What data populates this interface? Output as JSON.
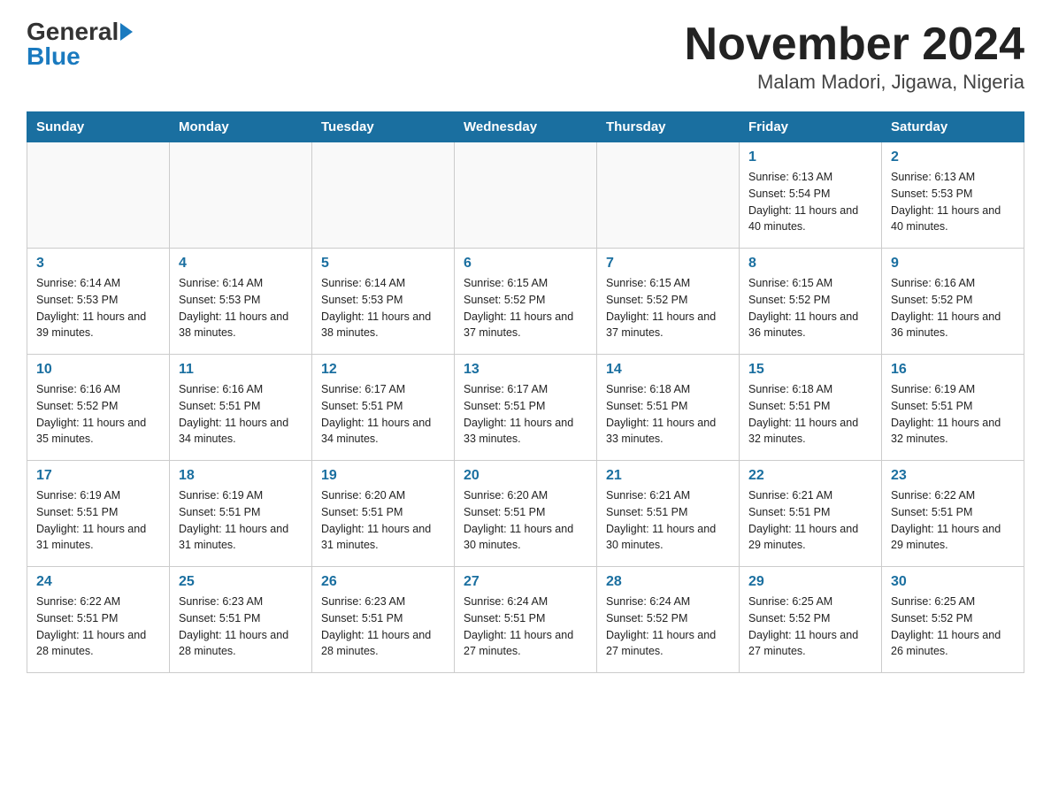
{
  "logo": {
    "general": "General",
    "blue": "Blue"
  },
  "header": {
    "month_year": "November 2024",
    "location": "Malam Madori, Jigawa, Nigeria"
  },
  "weekdays": [
    "Sunday",
    "Monday",
    "Tuesday",
    "Wednesday",
    "Thursday",
    "Friday",
    "Saturday"
  ],
  "weeks": [
    [
      {
        "day": "",
        "sunrise": "",
        "sunset": "",
        "daylight": ""
      },
      {
        "day": "",
        "sunrise": "",
        "sunset": "",
        "daylight": ""
      },
      {
        "day": "",
        "sunrise": "",
        "sunset": "",
        "daylight": ""
      },
      {
        "day": "",
        "sunrise": "",
        "sunset": "",
        "daylight": ""
      },
      {
        "day": "",
        "sunrise": "",
        "sunset": "",
        "daylight": ""
      },
      {
        "day": "1",
        "sunrise": "Sunrise: 6:13 AM",
        "sunset": "Sunset: 5:54 PM",
        "daylight": "Daylight: 11 hours and 40 minutes."
      },
      {
        "day": "2",
        "sunrise": "Sunrise: 6:13 AM",
        "sunset": "Sunset: 5:53 PM",
        "daylight": "Daylight: 11 hours and 40 minutes."
      }
    ],
    [
      {
        "day": "3",
        "sunrise": "Sunrise: 6:14 AM",
        "sunset": "Sunset: 5:53 PM",
        "daylight": "Daylight: 11 hours and 39 minutes."
      },
      {
        "day": "4",
        "sunrise": "Sunrise: 6:14 AM",
        "sunset": "Sunset: 5:53 PM",
        "daylight": "Daylight: 11 hours and 38 minutes."
      },
      {
        "day": "5",
        "sunrise": "Sunrise: 6:14 AM",
        "sunset": "Sunset: 5:53 PM",
        "daylight": "Daylight: 11 hours and 38 minutes."
      },
      {
        "day": "6",
        "sunrise": "Sunrise: 6:15 AM",
        "sunset": "Sunset: 5:52 PM",
        "daylight": "Daylight: 11 hours and 37 minutes."
      },
      {
        "day": "7",
        "sunrise": "Sunrise: 6:15 AM",
        "sunset": "Sunset: 5:52 PM",
        "daylight": "Daylight: 11 hours and 37 minutes."
      },
      {
        "day": "8",
        "sunrise": "Sunrise: 6:15 AM",
        "sunset": "Sunset: 5:52 PM",
        "daylight": "Daylight: 11 hours and 36 minutes."
      },
      {
        "day": "9",
        "sunrise": "Sunrise: 6:16 AM",
        "sunset": "Sunset: 5:52 PM",
        "daylight": "Daylight: 11 hours and 36 minutes."
      }
    ],
    [
      {
        "day": "10",
        "sunrise": "Sunrise: 6:16 AM",
        "sunset": "Sunset: 5:52 PM",
        "daylight": "Daylight: 11 hours and 35 minutes."
      },
      {
        "day": "11",
        "sunrise": "Sunrise: 6:16 AM",
        "sunset": "Sunset: 5:51 PM",
        "daylight": "Daylight: 11 hours and 34 minutes."
      },
      {
        "day": "12",
        "sunrise": "Sunrise: 6:17 AM",
        "sunset": "Sunset: 5:51 PM",
        "daylight": "Daylight: 11 hours and 34 minutes."
      },
      {
        "day": "13",
        "sunrise": "Sunrise: 6:17 AM",
        "sunset": "Sunset: 5:51 PM",
        "daylight": "Daylight: 11 hours and 33 minutes."
      },
      {
        "day": "14",
        "sunrise": "Sunrise: 6:18 AM",
        "sunset": "Sunset: 5:51 PM",
        "daylight": "Daylight: 11 hours and 33 minutes."
      },
      {
        "day": "15",
        "sunrise": "Sunrise: 6:18 AM",
        "sunset": "Sunset: 5:51 PM",
        "daylight": "Daylight: 11 hours and 32 minutes."
      },
      {
        "day": "16",
        "sunrise": "Sunrise: 6:19 AM",
        "sunset": "Sunset: 5:51 PM",
        "daylight": "Daylight: 11 hours and 32 minutes."
      }
    ],
    [
      {
        "day": "17",
        "sunrise": "Sunrise: 6:19 AM",
        "sunset": "Sunset: 5:51 PM",
        "daylight": "Daylight: 11 hours and 31 minutes."
      },
      {
        "day": "18",
        "sunrise": "Sunrise: 6:19 AM",
        "sunset": "Sunset: 5:51 PM",
        "daylight": "Daylight: 11 hours and 31 minutes."
      },
      {
        "day": "19",
        "sunrise": "Sunrise: 6:20 AM",
        "sunset": "Sunset: 5:51 PM",
        "daylight": "Daylight: 11 hours and 31 minutes."
      },
      {
        "day": "20",
        "sunrise": "Sunrise: 6:20 AM",
        "sunset": "Sunset: 5:51 PM",
        "daylight": "Daylight: 11 hours and 30 minutes."
      },
      {
        "day": "21",
        "sunrise": "Sunrise: 6:21 AM",
        "sunset": "Sunset: 5:51 PM",
        "daylight": "Daylight: 11 hours and 30 minutes."
      },
      {
        "day": "22",
        "sunrise": "Sunrise: 6:21 AM",
        "sunset": "Sunset: 5:51 PM",
        "daylight": "Daylight: 11 hours and 29 minutes."
      },
      {
        "day": "23",
        "sunrise": "Sunrise: 6:22 AM",
        "sunset": "Sunset: 5:51 PM",
        "daylight": "Daylight: 11 hours and 29 minutes."
      }
    ],
    [
      {
        "day": "24",
        "sunrise": "Sunrise: 6:22 AM",
        "sunset": "Sunset: 5:51 PM",
        "daylight": "Daylight: 11 hours and 28 minutes."
      },
      {
        "day": "25",
        "sunrise": "Sunrise: 6:23 AM",
        "sunset": "Sunset: 5:51 PM",
        "daylight": "Daylight: 11 hours and 28 minutes."
      },
      {
        "day": "26",
        "sunrise": "Sunrise: 6:23 AM",
        "sunset": "Sunset: 5:51 PM",
        "daylight": "Daylight: 11 hours and 28 minutes."
      },
      {
        "day": "27",
        "sunrise": "Sunrise: 6:24 AM",
        "sunset": "Sunset: 5:51 PM",
        "daylight": "Daylight: 11 hours and 27 minutes."
      },
      {
        "day": "28",
        "sunrise": "Sunrise: 6:24 AM",
        "sunset": "Sunset: 5:52 PM",
        "daylight": "Daylight: 11 hours and 27 minutes."
      },
      {
        "day": "29",
        "sunrise": "Sunrise: 6:25 AM",
        "sunset": "Sunset: 5:52 PM",
        "daylight": "Daylight: 11 hours and 27 minutes."
      },
      {
        "day": "30",
        "sunrise": "Sunrise: 6:25 AM",
        "sunset": "Sunset: 5:52 PM",
        "daylight": "Daylight: 11 hours and 26 minutes."
      }
    ]
  ]
}
